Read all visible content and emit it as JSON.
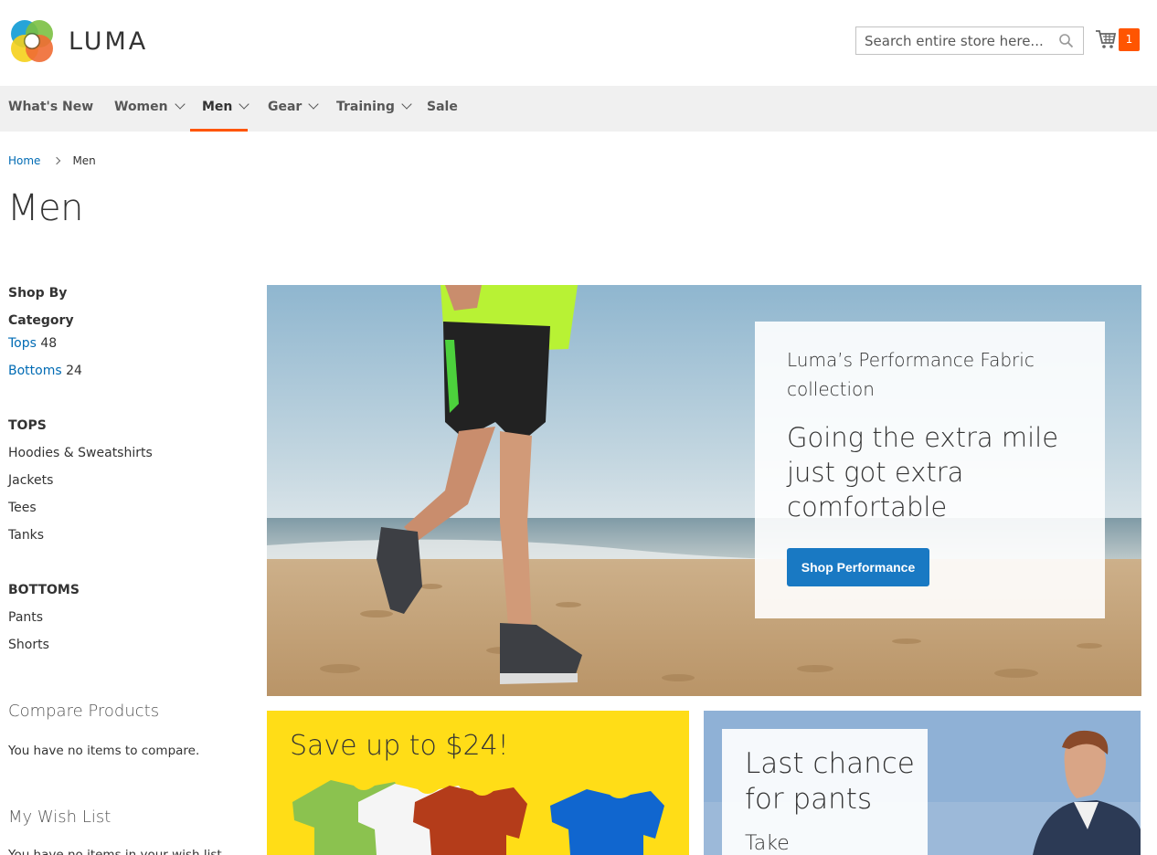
{
  "header": {
    "logo_text": "LUMA",
    "search_placeholder": "Search entire store here...",
    "cart_count": "1",
    "accent_color": "#ff5501"
  },
  "nav": {
    "items": [
      {
        "label": "What's New",
        "has_dropdown": false
      },
      {
        "label": "Women",
        "has_dropdown": true
      },
      {
        "label": "Men",
        "has_dropdown": true,
        "active": true
      },
      {
        "label": "Gear",
        "has_dropdown": true
      },
      {
        "label": "Training",
        "has_dropdown": true
      },
      {
        "label": "Sale",
        "has_dropdown": false
      }
    ]
  },
  "breadcrumb": {
    "home": "Home",
    "current": "Men"
  },
  "page_title": "Men",
  "sidebar": {
    "shop_by": "Shop By",
    "category_title": "Category",
    "categories": [
      {
        "label": "Tops",
        "count": "48"
      },
      {
        "label": "Bottoms",
        "count": "24"
      }
    ],
    "tops_title": "TOPS",
    "tops_items": [
      "Hoodies & Sweatshirts",
      "Jackets",
      "Tees",
      "Tanks"
    ],
    "bottoms_title": "BOTTOMS",
    "bottoms_items": [
      "Pants",
      "Shorts"
    ],
    "compare_title": "Compare Products",
    "compare_empty": "You have no items to compare.",
    "wishlist_title": "My Wish List",
    "wishlist_empty": "You have no items in your wish list."
  },
  "hero": {
    "subtitle": "Luma’s Performance Fabric collection",
    "title": "Going the extra mile just got extra comfortable",
    "button_label": "Shop Performance",
    "button_color": "#1979c3"
  },
  "promos": {
    "yellow_title": "Save up to $24!",
    "blue_title": "Last chance for pants",
    "blue_take": "Take"
  }
}
